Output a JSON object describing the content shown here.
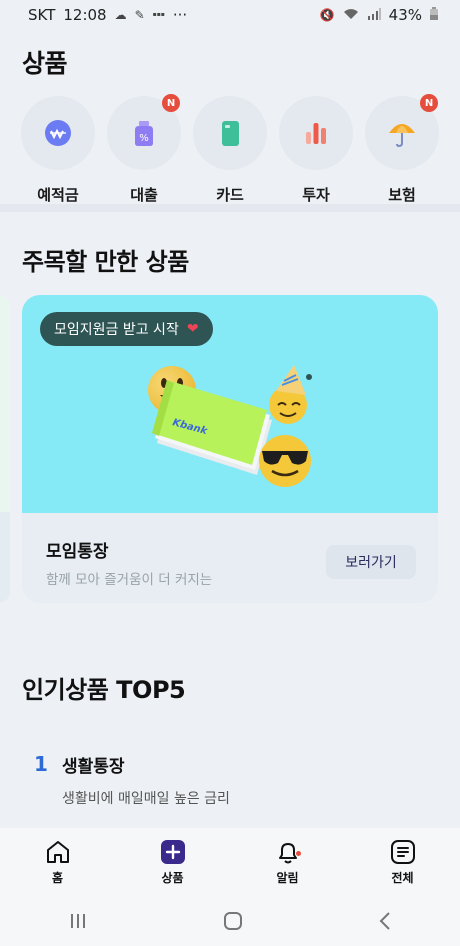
{
  "status_bar": {
    "carrier": "SKT",
    "time": "12:08",
    "dots": "···",
    "battery": "43%"
  },
  "products_title": "상품",
  "categories": [
    {
      "label": "예적금",
      "icon": "savings-icon",
      "badge": null,
      "color": "#6b7cf2"
    },
    {
      "label": "대출",
      "icon": "loan-icon",
      "badge": "N",
      "color": "#8e7cf2"
    },
    {
      "label": "카드",
      "icon": "card-icon",
      "badge": null,
      "color": "#3ebf9a"
    },
    {
      "label": "투자",
      "icon": "invest-icon",
      "badge": null,
      "color": "#f08070"
    },
    {
      "label": "보험",
      "icon": "umbrella-icon",
      "badge": "N",
      "color": "#f5a623"
    }
  ],
  "featured": {
    "heading": "주목할 만한 상품",
    "pill_text": "모임지원금 받고 시작",
    "pill_heart": "❤️",
    "brand_text": "Kbank",
    "card_title": "모임통장",
    "card_subtitle": "함께 모아 즐거움이 더 커지는",
    "button_label": "보러가기"
  },
  "popular": {
    "heading": "인기상품 TOP5",
    "items": [
      {
        "rank": "1",
        "title": "생활통장",
        "subtitle": "생활비에 매일매일 높은 금리"
      }
    ]
  },
  "bottom_nav": [
    {
      "label": "홈",
      "icon": "home-icon"
    },
    {
      "label": "상품",
      "icon": "plus-square-icon"
    },
    {
      "label": "알림",
      "icon": "bell-icon"
    },
    {
      "label": "전체",
      "icon": "menu-icon"
    }
  ],
  "colors": {
    "accent": "#3a2a8c",
    "rank_blue": "#2d6ad6",
    "badge_red": "#e54d3d",
    "card_cyan": "#86e9f6"
  }
}
